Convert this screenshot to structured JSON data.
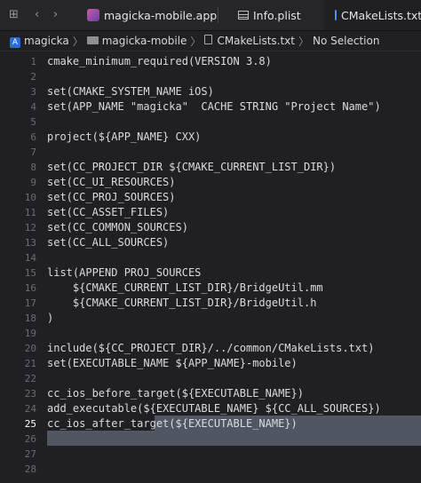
{
  "tabs": [
    {
      "label": "magicka-mobile.app",
      "icon": "app-icon"
    },
    {
      "label": "Info.plist",
      "icon": "plist-icon"
    },
    {
      "label": "CMakeLists.txt",
      "icon": "document-icon"
    }
  ],
  "breadcrumb": {
    "project": "magicka",
    "folder": "magicka-mobile",
    "file": "CMakeLists.txt",
    "selection": "No Selection"
  },
  "editor": {
    "current_line": 25,
    "lines": [
      {
        "n": "1",
        "text": "cmake_minimum_required(VERSION 3.8)"
      },
      {
        "n": "2",
        "text": ""
      },
      {
        "n": "3",
        "text": "set(CMAKE_SYSTEM_NAME iOS)"
      },
      {
        "n": "4",
        "text": "set(APP_NAME \"magicka\"  CACHE STRING \"Project Name\")"
      },
      {
        "n": "5",
        "text": ""
      },
      {
        "n": "6",
        "text": "project(${APP_NAME} CXX)"
      },
      {
        "n": "7",
        "text": ""
      },
      {
        "n": "8",
        "text": "set(CC_PROJECT_DIR ${CMAKE_CURRENT_LIST_DIR})"
      },
      {
        "n": "9",
        "text": "set(CC_UI_RESOURCES)"
      },
      {
        "n": "10",
        "text": "set(CC_PROJ_SOURCES)"
      },
      {
        "n": "11",
        "text": "set(CC_ASSET_FILES)"
      },
      {
        "n": "12",
        "text": "set(CC_COMMON_SOURCES)"
      },
      {
        "n": "13",
        "text": "set(CC_ALL_SOURCES)"
      },
      {
        "n": "14",
        "text": ""
      },
      {
        "n": "15",
        "text": "list(APPEND PROJ_SOURCES"
      },
      {
        "n": "16",
        "text": "    ${CMAKE_CURRENT_LIST_DIR}/BridgeUtil.mm"
      },
      {
        "n": "17",
        "text": "    ${CMAKE_CURRENT_LIST_DIR}/BridgeUtil.h"
      },
      {
        "n": "18",
        "text": ")"
      },
      {
        "n": "19",
        "text": ""
      },
      {
        "n": "20",
        "text": "include(${CC_PROJECT_DIR}/../common/CMakeLists.txt)"
      },
      {
        "n": "21",
        "text": "set(EXECUTABLE_NAME ${APP_NAME}-mobile)"
      },
      {
        "n": "22",
        "text": ""
      },
      {
        "n": "23",
        "text": "cc_ios_before_target(${EXECUTABLE_NAME})"
      },
      {
        "n": "24",
        "text": "add_executable(${EXECUTABLE_NAME} ${CC_ALL_SOURCES})"
      },
      {
        "n": "25",
        "text": "cc_ios_after_target(${EXECUTABLE_NAME})"
      },
      {
        "n": "26",
        "text": ""
      },
      {
        "n": "27",
        "text": ""
      },
      {
        "n": "28",
        "text": ""
      }
    ]
  }
}
